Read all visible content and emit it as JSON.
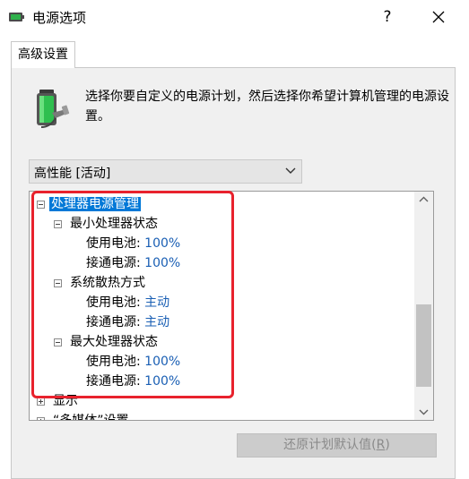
{
  "window": {
    "title": "电源选项",
    "help_label": "?",
    "close_label": "✕",
    "app_icon": "power-options-icon"
  },
  "tabs": [
    {
      "label": "高级设置",
      "active": true
    }
  ],
  "description": "选择你要自定义的电源计划，然后选择你希望计算机管理的电源设置。",
  "plan_dropdown": {
    "selected": "高性能 [活动]",
    "chevron": "chevron-down-icon"
  },
  "tree": {
    "root": "处理器电源管理",
    "min_state": {
      "label": "最小处理器状态",
      "battery_label": "使用电池:",
      "battery_value": "100%",
      "plugged_label": "接通电源:",
      "plugged_value": "100%"
    },
    "cooling": {
      "label": "系统散热方式",
      "battery_label": "使用电池:",
      "battery_value": "主动",
      "plugged_label": "接通电源:",
      "plugged_value": "主动"
    },
    "max_state": {
      "label": "最大处理器状态",
      "battery_label": "使用电池:",
      "battery_value": "100%",
      "plugged_label": "接通电源:",
      "plugged_value": "100%"
    },
    "display": "显示",
    "multimedia": "“多媒体”设置"
  },
  "restore_button": {
    "label_prefix": "还原计划默认值(",
    "label_hotkey": "R",
    "label_suffix": ")",
    "enabled": false
  },
  "colors": {
    "highlight": "#e8222d",
    "selection": "#0078d7",
    "value_text": "#1a5fb4"
  }
}
